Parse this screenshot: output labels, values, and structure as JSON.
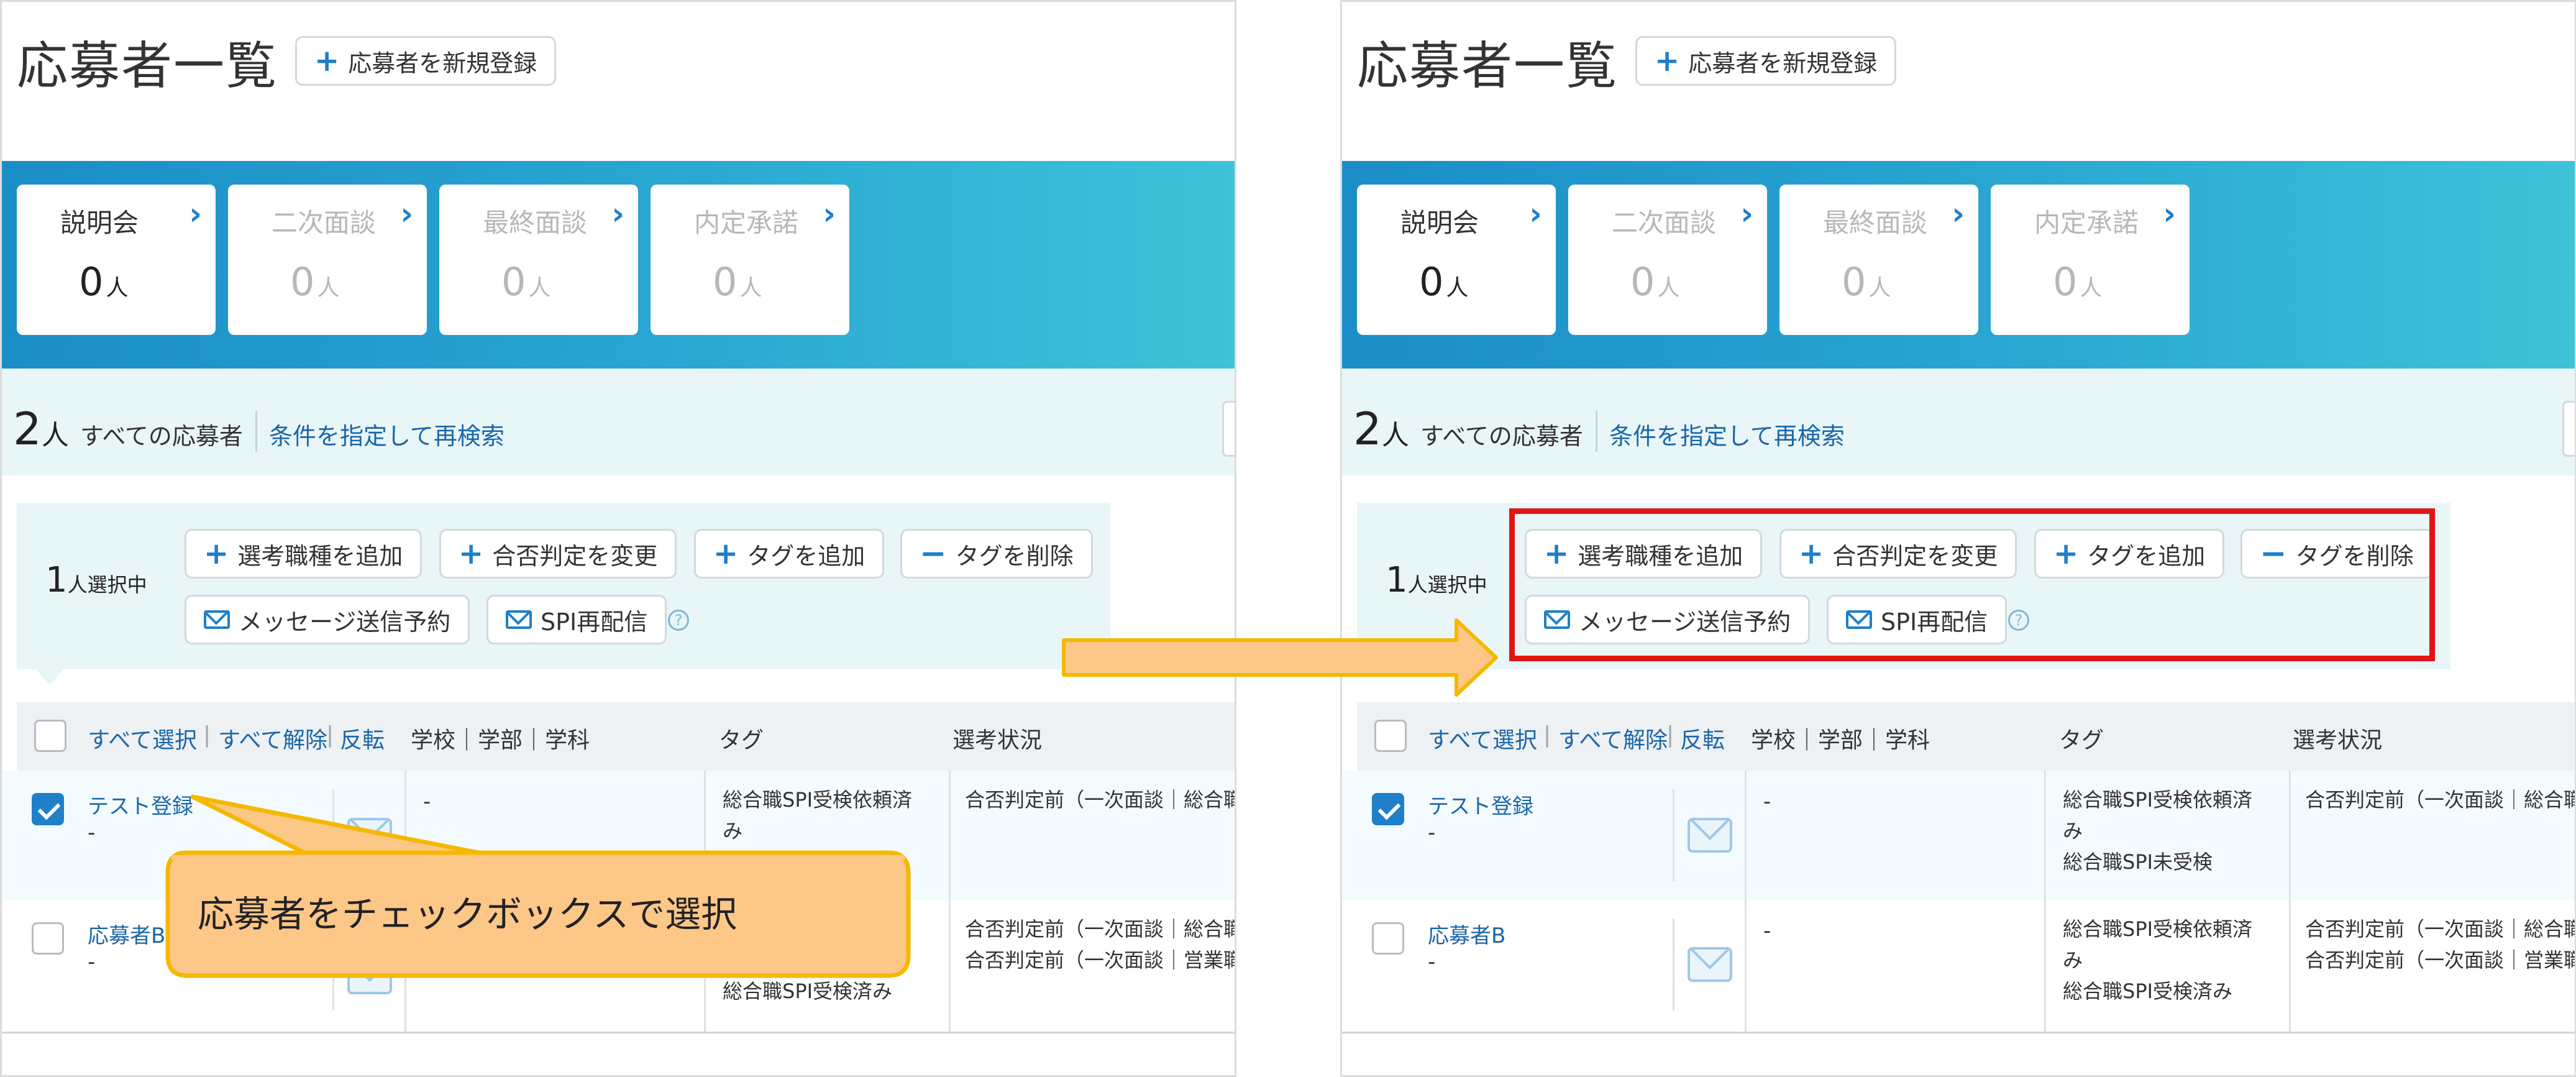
{
  "page_title": "応募者一覧",
  "register_button": "応募者を新規登録",
  "stages": [
    {
      "label": "説明会",
      "count": "0",
      "unit": "人",
      "active": true
    },
    {
      "label": "二次面談",
      "count": "0",
      "unit": "人",
      "active": false
    },
    {
      "label": "最終面談",
      "count": "0",
      "unit": "人",
      "active": false
    },
    {
      "label": "内定承諾",
      "count": "0",
      "unit": "人",
      "active": false
    }
  ],
  "summary": {
    "count": "2",
    "unit": "人",
    "label": "すべての応募者",
    "link": "条件を指定して再検索"
  },
  "selection": {
    "count": "1",
    "unit": "人選択中"
  },
  "actions": {
    "add_job": "選考職種を追加",
    "change_result": "合否判定を変更",
    "add_tag": "タグを追加",
    "remove_tag": "タグを削除",
    "schedule_message": "メッセージ送信予約",
    "resend_spi": "SPI再配信",
    "help": "?"
  },
  "table": {
    "select_all": "すべて選択",
    "deselect_all": "すべて解除",
    "invert": "反転",
    "pipe": "|",
    "col_school": "学校｜学部｜学科",
    "col_tag": "タグ",
    "col_status": "選考状況"
  },
  "rows": [
    {
      "name": "テスト登録",
      "sub": "-",
      "school": "-",
      "checked": true,
      "tags": [
        "総合職SPI受検依頼済",
        "み",
        "総合職SPI未受検"
      ],
      "tags_left": [
        "総合職SPI受検依頼済",
        "み"
      ],
      "status": [
        "合否判定前（一次面談｜総合職"
      ]
    },
    {
      "name": "応募者B",
      "sub": "-",
      "school": "-",
      "checked": false,
      "tags": [
        "総合職SPI受検依頼済",
        "み",
        "総合職SPI受検済み"
      ],
      "tags_left": [
        "総合職SPI受検済み"
      ],
      "status": [
        "合否判定前（一次面談｜総合職",
        "合否判定前（一次面談｜営業職"
      ]
    }
  ],
  "callout": "応募者をチェックボックスで選択",
  "colors": {
    "accent": "#1f7fc8",
    "callout_fill": "#fdc788",
    "callout_border": "#f5b800",
    "arrow_fill": "#fdc788",
    "highlight": "#e31414"
  }
}
